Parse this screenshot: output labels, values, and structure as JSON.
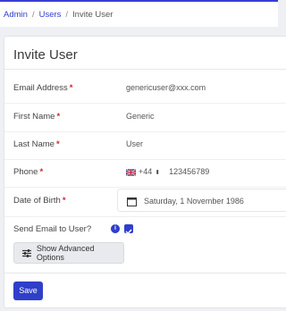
{
  "breadcrumb": {
    "items": [
      {
        "label": "Admin"
      },
      {
        "label": "Users"
      },
      {
        "label": "Invite User"
      }
    ],
    "separator": "/"
  },
  "card": {
    "title": "Invite User"
  },
  "form": {
    "email": {
      "label": "Email Address",
      "required_mark": "*",
      "value": "genericuser@xxx.com"
    },
    "first_name": {
      "label": "First Name",
      "required_mark": "*",
      "value": "Generic"
    },
    "last_name": {
      "label": "Last Name",
      "required_mark": "*",
      "value": "User"
    },
    "phone": {
      "label": "Phone",
      "required_mark": "*",
      "country_icon": "uk-flag-icon",
      "dial_code": "+44",
      "chevron": "⬍",
      "value": "123456789"
    },
    "dob": {
      "label": "Date of Birth",
      "required_mark": "*",
      "icon": "calendar-icon",
      "value": "Saturday, 1 November 1986"
    },
    "send_email": {
      "label": "Send Email to User?",
      "info_icon": "i",
      "checked": true
    }
  },
  "buttons": {
    "advanced_label": "Show Advanced Options",
    "save_label": "Save"
  },
  "colors": {
    "accent": "#2f3fc9",
    "required": "#d0252b"
  }
}
